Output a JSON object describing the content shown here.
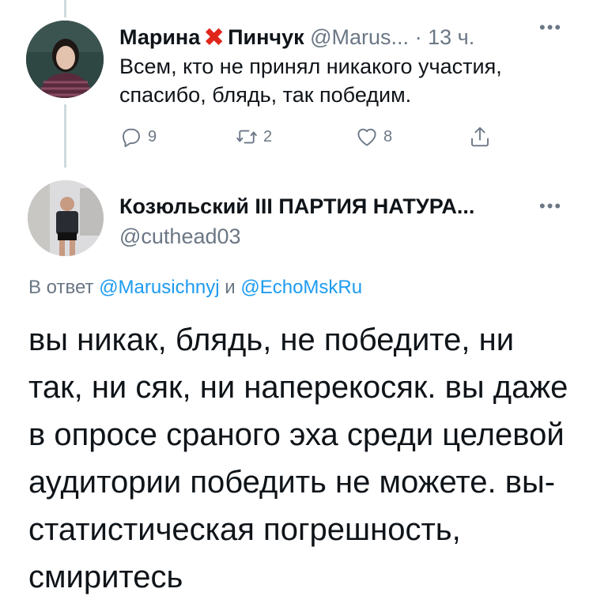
{
  "tweet1": {
    "name_first": "Марина",
    "name_mark": "✖",
    "name_last": "Пинчук",
    "handle": "@Marus...",
    "separator": "·",
    "time": "13 ч.",
    "more": "•••",
    "text": "Всем, кто не принял никакого участия, спасибо, блядь, так победим.",
    "replies": "9",
    "retweets": "2",
    "likes": "8"
  },
  "tweet2": {
    "name": "Козюльский III ПАРТИЯ НАТУРА...",
    "handle": "@cuthead03",
    "more": "•••",
    "reply_prefix": "В ответ",
    "reply_user1": "@Marusichnyj",
    "reply_and": "и",
    "reply_user2": "@EchoMskRu",
    "text": "вы никак, блядь, не победите, ни так, ни сяк, ни наперекосяк. вы даже в опросе сраного эха среди целевой аудитории победить не можете. вы-статистическая погрешность, смиритесь"
  },
  "colors": {
    "text": "#0f1419",
    "secondary": "#6b7785",
    "link": "#1d9bf0",
    "x_mark": "#e0261b",
    "thread_line": "#cfd9de"
  },
  "icons": [
    "reply-icon",
    "retweet-icon",
    "like-icon",
    "share-icon",
    "more-icon"
  ]
}
